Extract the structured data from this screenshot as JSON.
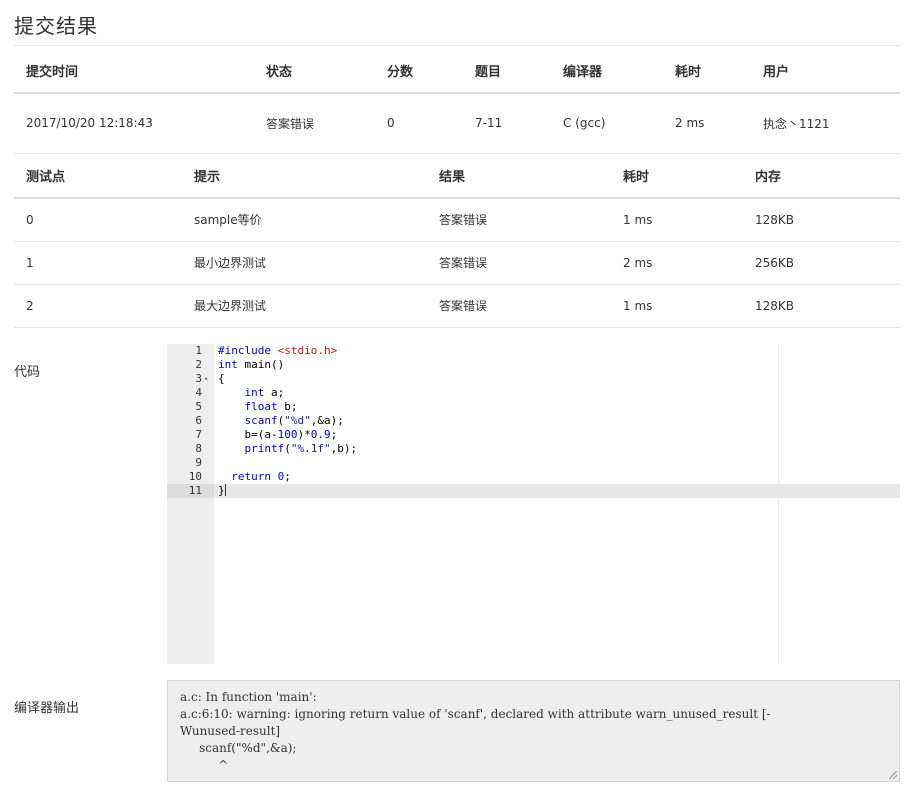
{
  "page": {
    "title": "提交结果"
  },
  "summary": {
    "headers": [
      "提交时间",
      "状态",
      "分数",
      "题目",
      "编译器",
      "耗时",
      "用户"
    ],
    "row": {
      "time": "2017/10/20 12:18:43",
      "status": "答案错误",
      "score": "0",
      "problem": "7-11",
      "compiler": "C (gcc)",
      "elapsed": "2 ms",
      "user": "执念丶1121"
    }
  },
  "cases": {
    "headers": [
      "测试点",
      "提示",
      "结果",
      "耗时",
      "内存"
    ],
    "rows": [
      {
        "id": "0",
        "hint": "sample等价",
        "result": "答案错误",
        "time": "1 ms",
        "memory": "128KB"
      },
      {
        "id": "1",
        "hint": "最小边界测试",
        "result": "答案错误",
        "time": "2 ms",
        "memory": "256KB"
      },
      {
        "id": "2",
        "hint": "最大边界测试",
        "result": "答案错误",
        "time": "1 ms",
        "memory": "128KB"
      }
    ]
  },
  "code": {
    "label": "代码",
    "line_numbers": [
      "1",
      "2",
      "3",
      "4",
      "5",
      "6",
      "7",
      "8",
      "9",
      "10",
      "11"
    ],
    "line1_directive": "#include ",
    "line1_header": "<stdio.h>",
    "line2_type": "int",
    "line2_rest": " main()",
    "line3": "{",
    "line4_indent": "    ",
    "line4_type": "int",
    "line4_rest": " a;",
    "line5_indent": "    ",
    "line5_type": "float",
    "line5_rest": " b;",
    "line6_indent": "    ",
    "line6_fn": "scanf",
    "line6_open": "(",
    "line6_fmt": "\"%d\"",
    "line6_rest": ",&a);",
    "line7_indent": "    ",
    "line7_pre": "b=(a-",
    "line7_num1": "100",
    "line7_mid": ")*",
    "line7_num2": "0.9",
    "line7_end": ";",
    "line8_indent": "    ",
    "line8_fn": "printf",
    "line8_open": "(",
    "line8_fmt": "\"%.1f\"",
    "line8_rest": ",b);",
    "line9": "",
    "line10_indent": "  ",
    "line10_kw": "return",
    "line10_sp": " ",
    "line10_num": "0",
    "line10_end": ";",
    "line11": "}",
    "fold_marker": "▾"
  },
  "compiler_output": {
    "label": "编译器输出",
    "lines": [
      "a.c: In function 'main':",
      "a.c:6:10: warning: ignoring return value of 'scanf', declared with attribute warn_unused_result [-",
      "Wunused-result]",
      "     scanf(\"%d\",&a);",
      "          ^"
    ]
  },
  "colors": {
    "status_wrong": "#4caf50",
    "link": "#2469b3",
    "gutter": "#eeeeee"
  }
}
